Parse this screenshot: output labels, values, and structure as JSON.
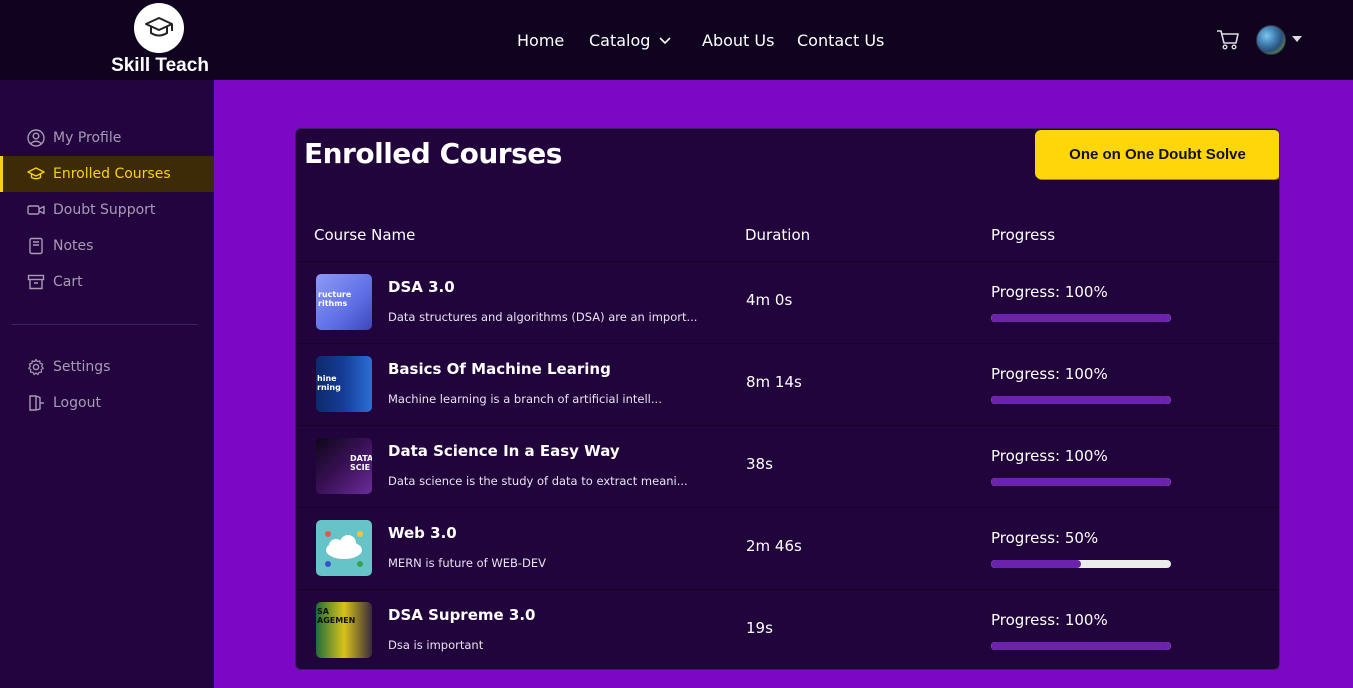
{
  "brand": {
    "name": "Skill Teach",
    "logo_icon": "graduation-cap-icon"
  },
  "nav": {
    "home": "Home",
    "catalog": "Catalog",
    "about": "About Us",
    "contact": "Contact Us"
  },
  "header_icons": {
    "cart": "cart-icon",
    "avatar": "user-avatar"
  },
  "sidebar": {
    "items": [
      {
        "label": "My Profile",
        "icon": "user-circle-icon",
        "active": false
      },
      {
        "label": "Enrolled Courses",
        "icon": "graduation-cap-icon",
        "active": true
      },
      {
        "label": "Doubt Support",
        "icon": "video-camera-icon",
        "active": false
      },
      {
        "label": "Notes",
        "icon": "notebook-icon",
        "active": false
      },
      {
        "label": "Cart",
        "icon": "archive-box-icon",
        "active": false
      }
    ],
    "bottom": [
      {
        "label": "Settings",
        "icon": "gear-icon"
      },
      {
        "label": "Logout",
        "icon": "logout-icon"
      }
    ]
  },
  "main": {
    "title": "Enrolled Courses",
    "doubt_button": "One on One Doubt Solve",
    "columns": {
      "name": "Course Name",
      "duration": "Duration",
      "progress": "Progress"
    },
    "courses": [
      {
        "name": "DSA 3.0",
        "description": "Data structures and algorithms (DSA) are an import...",
        "duration": "4m 0s",
        "progress_label": "Progress: 100%",
        "progress": 100,
        "thumb_text": "ructure\nrithms"
      },
      {
        "name": "Basics Of Machine Learing",
        "description": "Machine learning is a branch of artificial intell...",
        "duration": "8m 14s",
        "progress_label": "Progress: 100%",
        "progress": 100,
        "thumb_text": "hine\nrning"
      },
      {
        "name": "Data Science In a Easy Way",
        "description": "Data science is the study of data to extract meani...",
        "duration": "38s",
        "progress_label": "Progress: 100%",
        "progress": 100,
        "thumb_text": "DATA\nSCIE"
      },
      {
        "name": "Web 3.0",
        "description": "MERN is future of WEB-DEV",
        "duration": "2m 46s",
        "progress_label": "Progress: 50%",
        "progress": 50,
        "thumb_text": ""
      },
      {
        "name": "DSA Supreme 3.0",
        "description": "Dsa is important",
        "duration": "19s",
        "progress_label": "Progress: 100%",
        "progress": 100,
        "thumb_text": "SA\nAGEMEN"
      }
    ]
  },
  "colors": {
    "page_bg": "#7c08c6",
    "header_bg": "#0f0320",
    "sidebar_bg": "#24043f",
    "card_bg": "#21043c",
    "accent_yellow": "#ffd60a",
    "progress_fill": "#6b22ad"
  }
}
